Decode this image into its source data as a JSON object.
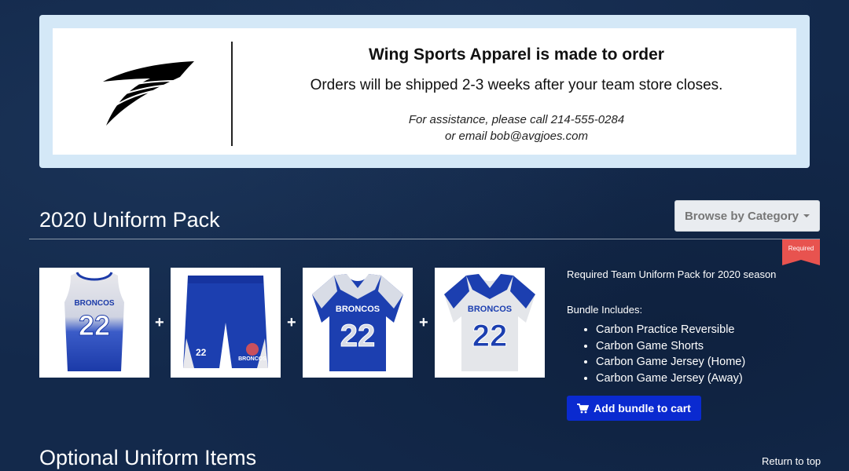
{
  "banner": {
    "title": "Wing Sports Apparel is made to order",
    "subtitle": "Orders will be shipped 2-3 weeks after your team store closes.",
    "assistance_line1": "For assistance, please call 214-555-0284",
    "assistance_line2": "or email bob@avgjoes.com",
    "logo_icon": "wing-logo"
  },
  "uniform_pack": {
    "title": "2020 Uniform Pack",
    "browse_label": "Browse by Category",
    "required_badge": "Required",
    "description": "Required Team Uniform Pack for 2020 season",
    "includes_label": "Bundle Includes:",
    "items": [
      "Carbon Practice Reversible",
      "Carbon Game Shorts",
      "Carbon Game Jersey (Home)",
      "Carbon Game Jersey (Away)"
    ],
    "products": [
      {
        "team": "BRONCOS",
        "number": "22",
        "type": "practice-reversible"
      },
      {
        "number": "22",
        "team": "BRONCOS",
        "type": "game-shorts"
      },
      {
        "team": "BRONCOS",
        "number": "22",
        "type": "home-jersey"
      },
      {
        "team": "BRONCOS",
        "number": "22",
        "type": "away-jersey"
      }
    ],
    "plus": "+",
    "add_bundle_label": "Add bundle to cart",
    "cart_icon": "cart-icon"
  },
  "optional": {
    "title": "Optional Uniform Items",
    "return_top": "Return to top"
  },
  "colors": {
    "background": "#13294b",
    "royal": "#1c3fb0",
    "add_button": "#0a2ad0",
    "required_red": "#e8534f",
    "banner_border": "#d4e8f7"
  }
}
